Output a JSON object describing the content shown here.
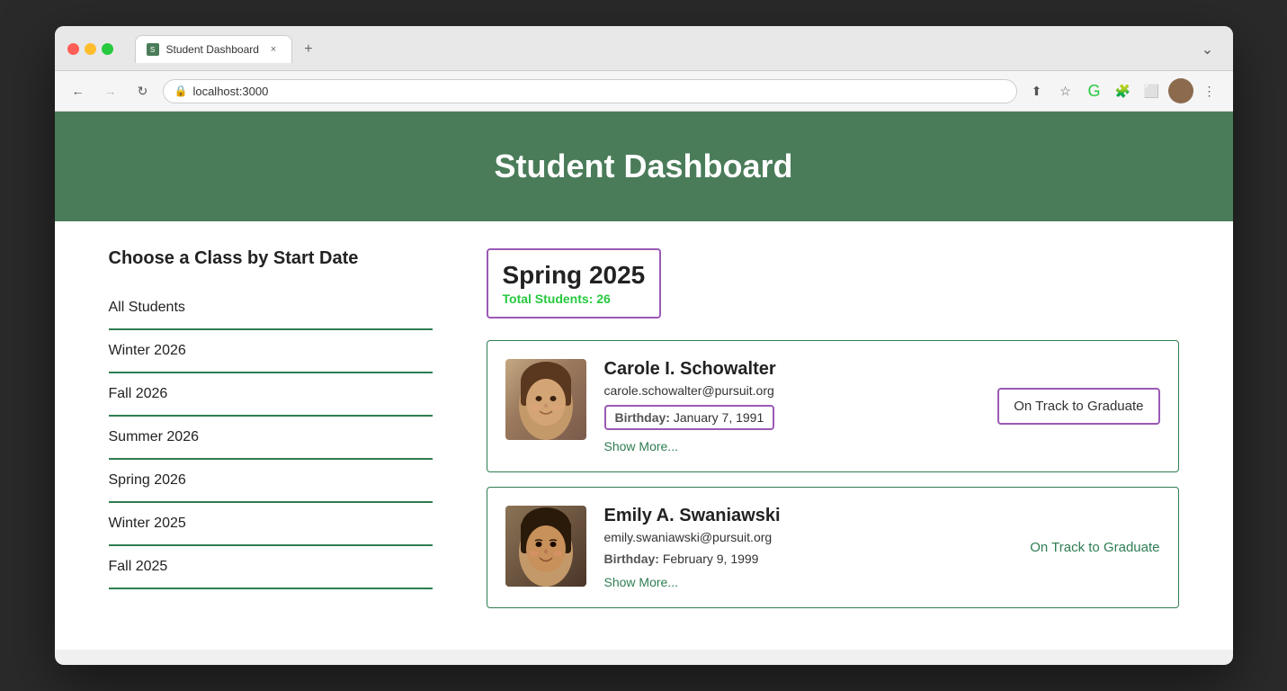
{
  "browser": {
    "tab_title": "Student Dashboard",
    "url": "localhost:3000",
    "back_btn": "←",
    "forward_btn": "→",
    "reload_btn": "↻"
  },
  "header": {
    "title": "Student Dashboard"
  },
  "sidebar": {
    "heading": "Choose a Class by Start Date",
    "items": [
      {
        "label": "All Students"
      },
      {
        "label": "Winter 2026"
      },
      {
        "label": "Fall 2026"
      },
      {
        "label": "Summer 2026"
      },
      {
        "label": "Spring 2026"
      },
      {
        "label": "Winter 2025"
      },
      {
        "label": "Fall 2025"
      }
    ]
  },
  "class": {
    "title": "Spring 2025",
    "subtitle": "Total Students:",
    "count": "26"
  },
  "students": [
    {
      "name": "Carole I. Schowalter",
      "email": "carole.schowalter@pursuit.org",
      "birthday_label": "Birthday:",
      "birthday": "January 7, 1991",
      "status": "On Track to Graduate",
      "show_more": "Show More...",
      "status_outlined": true,
      "birthday_outlined": true
    },
    {
      "name": "Emily A. Swaniawski",
      "email": "emily.swaniawski@pursuit.org",
      "birthday_label": "Birthday:",
      "birthday": "February 9, 1999",
      "status": "On Track to Graduate",
      "show_more": "Show More...",
      "status_outlined": false,
      "birthday_outlined": false
    }
  ],
  "icons": {
    "lock": "🔒",
    "upload": "⬆",
    "star": "☆",
    "extensions": "🧩",
    "menu": "⋮",
    "window": "⬜"
  }
}
